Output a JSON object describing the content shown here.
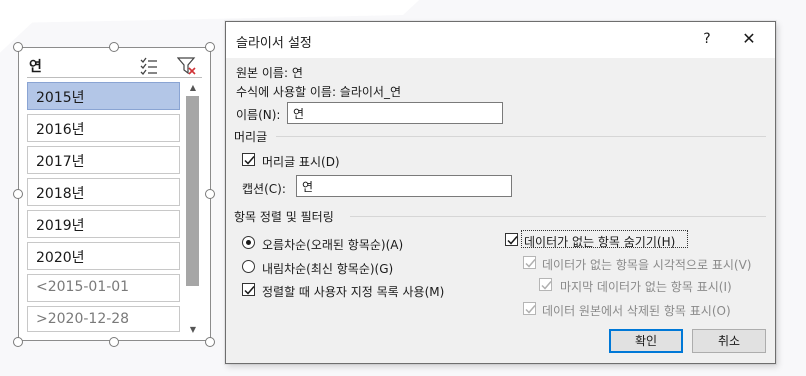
{
  "slicer": {
    "title": "연",
    "icons": {
      "multiselect": "multi-select-icon",
      "clear_filter": "clear-filter-icon"
    },
    "items": [
      {
        "label": "2015년",
        "state": "selected"
      },
      {
        "label": "2016년",
        "state": "normal"
      },
      {
        "label": "2017년",
        "state": "normal"
      },
      {
        "label": "2018년",
        "state": "normal"
      },
      {
        "label": "2019년",
        "state": "normal"
      },
      {
        "label": "2020년",
        "state": "normal"
      },
      {
        "label": "<2015-01-01",
        "state": "nodata"
      },
      {
        "label": ">2020-12-28",
        "state": "nodata"
      }
    ]
  },
  "dialog": {
    "title": "슬라이서 설정",
    "help_label": "?",
    "close_label": "✕",
    "source_name": "원본 이름:  연",
    "formula_name": "수식에 사용할 이름:  슬라이서_연",
    "name_label": "이름(N):",
    "name_value": "연",
    "header_section": "머리글",
    "show_header_label": "머리글 표시(D)",
    "caption_label": "캡션(C):",
    "caption_value": "연",
    "sort_section": "항목 정렬 및 필터링",
    "sort_options": [
      {
        "label": "오름차순(오래된 항목순)(A)",
        "checked": true
      },
      {
        "label": "내림차순(최신 항목순)(G)",
        "checked": false
      }
    ],
    "custom_list_label": "정렬할 때 사용자 지정 목록 사용(M)",
    "hide_nodata_label": "데이터가 없는 항목 숨기기(H)",
    "visual_nodata_label": "데이터가 없는 항목을 시각적으로 표시(V)",
    "show_last_label": "마지막 데이터가 없는 항목 표시(I)",
    "show_deleted_label": "데이터 원본에서 삭제된 항목 표시(O)",
    "ok_label": "확인",
    "cancel_label": "취소"
  },
  "colors": {
    "selected_item": "#b3c6e7",
    "default_button_border": "#0078d7",
    "dialog_bg": "#f0f0f0"
  }
}
